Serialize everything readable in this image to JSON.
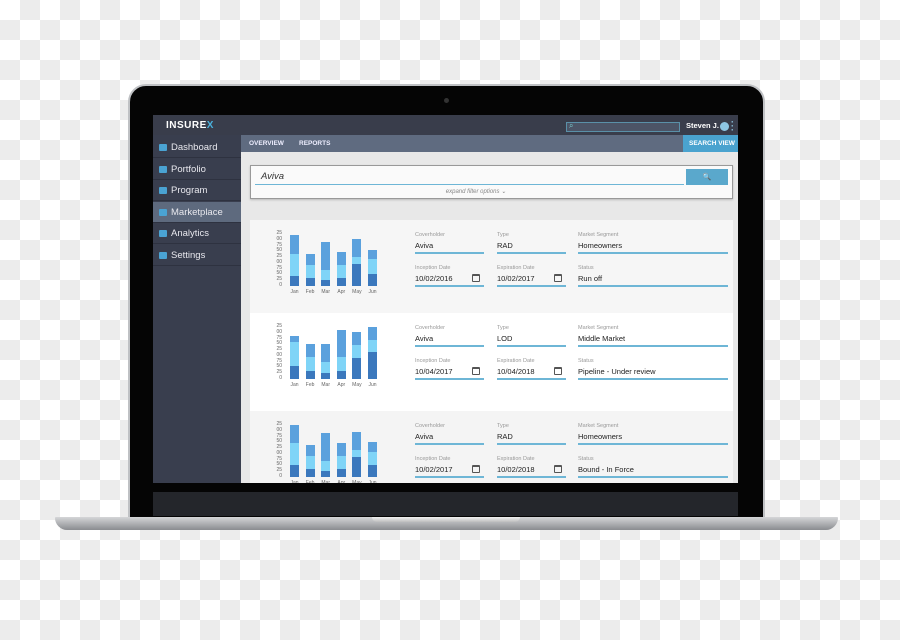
{
  "app": {
    "logo": "INSURE",
    "logo_x": "X",
    "user": "Steven J."
  },
  "sidebar": {
    "items": [
      {
        "label": "Dashboard",
        "icon": "chart-icon"
      },
      {
        "label": "Portfolio",
        "icon": "document-icon"
      },
      {
        "label": "Program",
        "icon": "list-icon"
      },
      {
        "label": "Marketplace",
        "icon": "folder-icon",
        "active": true
      },
      {
        "label": "Analytics",
        "icon": "cloud-icon"
      },
      {
        "label": "Settings",
        "icon": "gear-icon"
      }
    ]
  },
  "nav": {
    "tabs": [
      "OVERVIEW",
      "REPORTS"
    ],
    "search_view": "SEARCH VIEW"
  },
  "search": {
    "value": "Aviva",
    "expand": "expand filter options ⌄",
    "button_icon": "🔍"
  },
  "labels": {
    "coverholder": "Coverholder",
    "type": "Type",
    "segment": "Market Segment",
    "inception": "Inception Date",
    "expiration": "Expiration Date",
    "status": "Status"
  },
  "colors": {
    "accent": "#4aa3cf",
    "bar_dark": "#3b78bd",
    "bar_light": "#7fd4f7",
    "bar_mid": "#5ba1dd"
  },
  "results": [
    {
      "coverholder": "Aviva",
      "type": "RAD",
      "segment": "Homeowners",
      "inception": "10/02/2016",
      "expiration": "10/02/2017",
      "status": "Run off"
    },
    {
      "coverholder": "Aviva",
      "type": "LOD",
      "segment": "Middle Market",
      "inception": "10/04/2017",
      "expiration": "10/04/2018",
      "status": "Pipeline - Under review"
    },
    {
      "coverholder": "Aviva",
      "type": "RAD",
      "segment": "Homeowners",
      "inception": "10/02/2017",
      "expiration": "10/02/2018",
      "status": "Bound - In Force"
    }
  ],
  "chart_data": [
    {
      "type": "bar",
      "stacked": true,
      "categories": [
        "Jan",
        "Feb",
        "Mar",
        "Apr",
        "May",
        "Jun"
      ],
      "ylim": [
        0,
        225
      ],
      "tick_labels": [
        "25",
        "00",
        "75",
        "50",
        "25",
        "00",
        "75",
        "50",
        "25",
        "0"
      ],
      "series": [
        {
          "values": [
            45,
            35,
            25,
            35,
            95,
            50
          ]
        },
        {
          "values": [
            95,
            55,
            45,
            55,
            30,
            65
          ]
        },
        {
          "values": [
            80,
            50,
            120,
            55,
            80,
            40
          ]
        }
      ]
    },
    {
      "type": "bar",
      "stacked": true,
      "categories": [
        "Jan",
        "Feb",
        "Mar",
        "Apr",
        "May",
        "Jun"
      ],
      "ylim": [
        0,
        225
      ],
      "tick_labels": [
        "25",
        "00",
        "75",
        "50",
        "25",
        "00",
        "75",
        "50",
        "25",
        "0"
      ],
      "series": [
        {
          "values": [
            55,
            35,
            25,
            35,
            90,
            115
          ]
        },
        {
          "values": [
            105,
            60,
            50,
            60,
            55,
            55
          ]
        },
        {
          "values": [
            25,
            55,
            75,
            115,
            60,
            55
          ]
        }
      ]
    },
    {
      "type": "bar",
      "stacked": true,
      "categories": [
        "Jan",
        "Feb",
        "Mar",
        "Apr",
        "May",
        "Jun"
      ],
      "ylim": [
        0,
        225
      ],
      "tick_labels": [
        "25",
        "00",
        "75",
        "50",
        "25",
        "00",
        "75",
        "50",
        "25",
        "0"
      ],
      "series": [
        {
          "values": [
            50,
            35,
            25,
            35,
            85,
            50
          ]
        },
        {
          "values": [
            95,
            55,
            45,
            55,
            30,
            60
          ]
        },
        {
          "values": [
            80,
            50,
            120,
            55,
            80,
            40
          ]
        }
      ]
    }
  ]
}
